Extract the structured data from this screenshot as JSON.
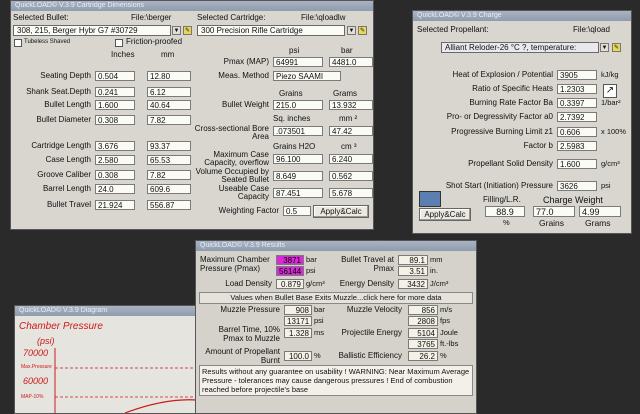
{
  "dims": {
    "title": "QuickLOAD© V.3.9 Cartridge Dimensions",
    "bullet_label": "Selected Bullet:",
    "bullet_file": "File:\\berger",
    "bullet_value": "308, 215, Berger Hybr G7 #30729",
    "cartridge_label": "Selected Cartridge:",
    "cartridge_file": "File:\\qloadlw",
    "cartridge_value": "300 Precision Rifle Cartridge",
    "check1": "Tubeless Shaved",
    "check2": "Friction-proofed",
    "col_inches": "Inches",
    "col_mm": "mm",
    "rows": [
      {
        "label": "Seating Depth",
        "in": "0.504",
        "mm": "12.80"
      },
      {
        "label": "Shank Seat.Depth",
        "in": "0.241",
        "mm": "6.12"
      },
      {
        "label": "Bullet Length",
        "in": "1.600",
        "mm": "40.64"
      },
      {
        "label": "Bullet Diameter",
        "in": "0.308",
        "mm": "7.82"
      },
      {
        "label": "Cartridge Length",
        "in": "3.676",
        "mm": "93.37"
      },
      {
        "label": "Case Length",
        "in": "2.580",
        "mm": "65.53"
      },
      {
        "label": "Groove Caliber",
        "in": "0.308",
        "mm": "7.82"
      },
      {
        "label": "Barrel Length",
        "in": "24.0",
        "mm": "609.6"
      },
      {
        "label": "Bullet Travel",
        "in": "21.924",
        "mm": "556.87"
      }
    ],
    "col_psi": "psi",
    "col_bar": "bar",
    "pmax_label": "Pmax (MAP)",
    "pmax_psi": "64991",
    "pmax_bar": "4481.0",
    "meas_label": "Meas. Method",
    "meas_value": "Piezo SAAMI",
    "col_grains": "Grains",
    "col_grams": "Grams",
    "weight_label": "Bullet Weight",
    "weight_gr": "215.0",
    "weight_g": "13.932",
    "col_sqin": "Sq. inches",
    "col_mm2": "mm ²",
    "bore_label": "Cross-sectional Bore Area",
    "bore_in": ".073501",
    "bore_mm": "47.42",
    "col_grh2o": "Grains H2O",
    "col_cm3": "cm ³",
    "cap_label": "Maximum Case Capacity, overflow",
    "cap_gr": "96.100",
    "cap_cm": "6.240",
    "occ_label": "Volume Occupied by Seated Bullet",
    "occ_gr": "8.649",
    "occ_cm": "0.562",
    "use_label": "Useable Case Capacity",
    "use_gr": "87.451",
    "use_cm": "5.678",
    "wf_label": "Weighting Factor",
    "wf_value": "0.5",
    "apply": "Apply&Calc"
  },
  "charge": {
    "title": "QuickLOAD© V.3.9 Charge",
    "prop_label": "Selected Propellant:",
    "prop_file": "File:\\qload",
    "prop_value": "Alliant Reloder-26 °C ?, temperature:",
    "rows": [
      {
        "label": "Heat of Explosion / Potential",
        "value": "3905",
        "unit": "kJ/kg"
      },
      {
        "label": "Ratio of Specific Heats",
        "value": "1.2303",
        "unit": ""
      },
      {
        "label": "Burning Rate Factor  Ba",
        "value": "0.3397",
        "unit": "1/bar²"
      },
      {
        "label": "Pro- or Degressivity Factor  a0",
        "value": "2.7392",
        "unit": ""
      },
      {
        "label": "Progressive Burning Limit z1",
        "value": "0.606",
        "unit": "x 100%"
      },
      {
        "label": "Factor  b",
        "value": "2.5983",
        "unit": ""
      },
      {
        "label": "Propellant Solid Density",
        "value": "1.600",
        "unit": "g/cm³"
      },
      {
        "label": "Shot Start (Initiation) Pressure",
        "value": "3626",
        "unit": "psi"
      }
    ],
    "fill_label": "Filling/L.R.",
    "weight_label": "Charge Weight",
    "fill_value": "88.9",
    "fill_unit": "%",
    "grains_value": "77.0",
    "grams_value": "4.99",
    "grains_unit": "Grains",
    "grams_unit": "Grams",
    "apply": "Apply&Calc"
  },
  "results": {
    "title": "QuickLOAD© V.3.9 Results",
    "pmax_label": "Maximum Chamber Pressure (Pmax)",
    "pmax_bar": "3871",
    "pmax_bar_unit": "bar",
    "pmax_psi": "56144",
    "pmax_psi_unit": "psi",
    "travel_label": "Bullet Travel at Pmax",
    "travel_mm": "89.1",
    "travel_mm_unit": "mm",
    "travel_in": "3.51",
    "travel_in_unit": "in.",
    "density_label": "Load Density",
    "density_value": "0.879",
    "density_unit": "g/cm³",
    "energy_label": "Energy Density",
    "energy_value": "3432",
    "energy_unit": "J/cm³",
    "banner": "Values when Bullet Base Exits Muzzle...click here for more data",
    "mp_label": "Muzzle Pressure",
    "mp_bar": "908",
    "mp_bar_unit": "bar",
    "mp_psi": "13171",
    "mp_psi_unit": "psi",
    "mv_label": "Muzzle Velocity",
    "mv_ms": "856",
    "mv_ms_unit": "m/s",
    "mv_fps": "2808",
    "mv_fps_unit": "fps",
    "bt_label": "Barrel Time, 10% Pmax to Muzzle",
    "bt_value": "1.328",
    "bt_unit": "ms",
    "pe_label": "Projectile Energy",
    "pe_j": "5104",
    "pe_j_unit": "Joule",
    "pe_ft": "3765",
    "pe_ft_unit": "ft.-lbs",
    "burnt_label": "Amount of Propellant Burnt",
    "burnt_value": "100.0",
    "burnt_unit": "%",
    "eff_label": "Ballistic Efficiency",
    "eff_value": "26.2",
    "eff_unit": "%",
    "warning": "Results without any guarantee on usability !  WARNING: Near Maximum Average Pressure - tolerances may cause dangerous pressures !  End of combustion reached before projectile's base"
  },
  "diagram": {
    "title": "QuickLOAD© V.3.9 Diagram",
    "heading": "Chamber Pressure",
    "unit": "(psi)",
    "ticks": [
      "70000",
      "60000"
    ],
    "max_label": "Max.Pressure",
    "mid_label": "MAP-10%"
  }
}
